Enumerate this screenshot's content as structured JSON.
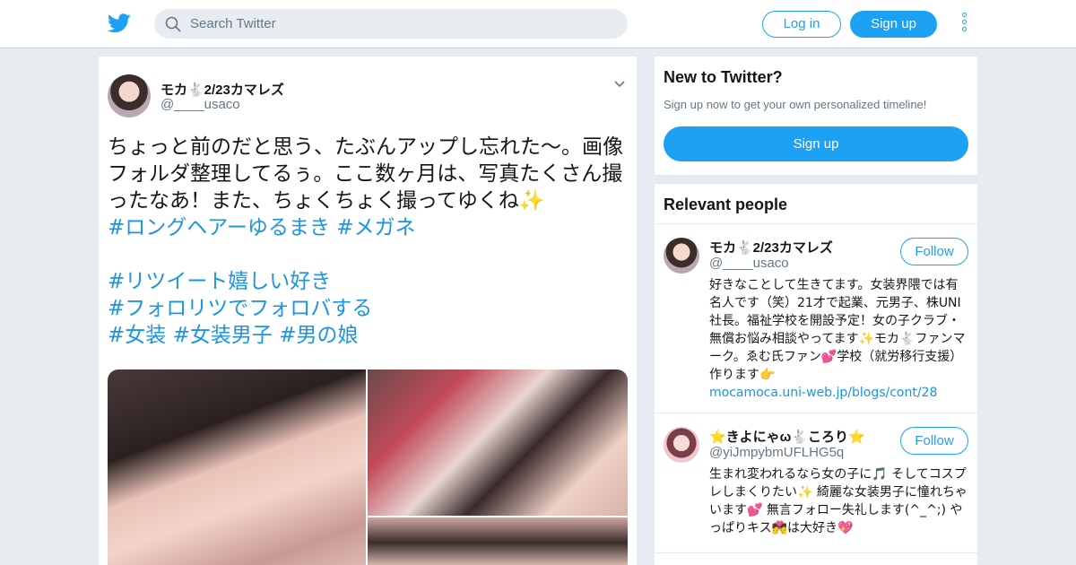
{
  "brand": {
    "accent": "#1da1f2",
    "background": "#e6ecf0",
    "link": "#1b95e0"
  },
  "header": {
    "logo_icon": "twitter-bird-icon",
    "search": {
      "icon": "search-icon",
      "placeholder": "Search Twitter",
      "value": ""
    },
    "login_label": "Log in",
    "signup_label": "Sign up",
    "more_icon": "vertical-dots-icon"
  },
  "tweet": {
    "author": {
      "display_name": "モカ🐇2/23カマレズ",
      "screen_name": "@____usaco"
    },
    "menu_icon": "chevron-down-icon",
    "text": "ちょっと前のだと思う、たぶんアップし忘れた〜。画像フォルダ整理してるぅ。ここ数ヶ月は、写真たくさん撮ったなあ！また、ちょくちょく撮ってゆくね✨",
    "hashtags": [
      "#ロングヘアーゆるまき",
      "#メガネ",
      "#リツイート嬉しい好き",
      "#フォロリツでフォロバする",
      "#女装",
      "#女装男子",
      "#男の娘"
    ],
    "media_count": 3
  },
  "signup_card": {
    "title": "New to Twitter?",
    "subtitle": "Sign up now to get your own personalized timeline!",
    "button": "Sign up"
  },
  "relevant_people": {
    "title": "Relevant people",
    "people": [
      {
        "display_name": "モカ🐇2/23カマレズ",
        "screen_name": "@____usaco",
        "follow_label": "Follow",
        "bio": "好きなことして生きてます。女装界隈では有名人です（笑）21才で起業、元男子、株UNI社長。福祉学校を開設予定！女の子クラブ・無償お悩み相談やってます✨モカ🐇ファンマーク。ゑむ氏ファン💕学校（就労移行支援）作ります👉",
        "link": "mocamoca.uni-web.jp/blogs/cont/28"
      },
      {
        "display_name": "⭐きよにゃω🐇ころり⭐",
        "screen_name": "@yiJmpybmUFLHG5q",
        "follow_label": "Follow",
        "bio": "生まれ変われるなら女の子に🎵 そしてコスプレしまくりたい✨ 綺麗な女装男子に憧れちゃいます💕 無言フォロー失礼します(^_^;) やっぱりキス💏は大好き💖",
        "link": ""
      }
    ]
  }
}
